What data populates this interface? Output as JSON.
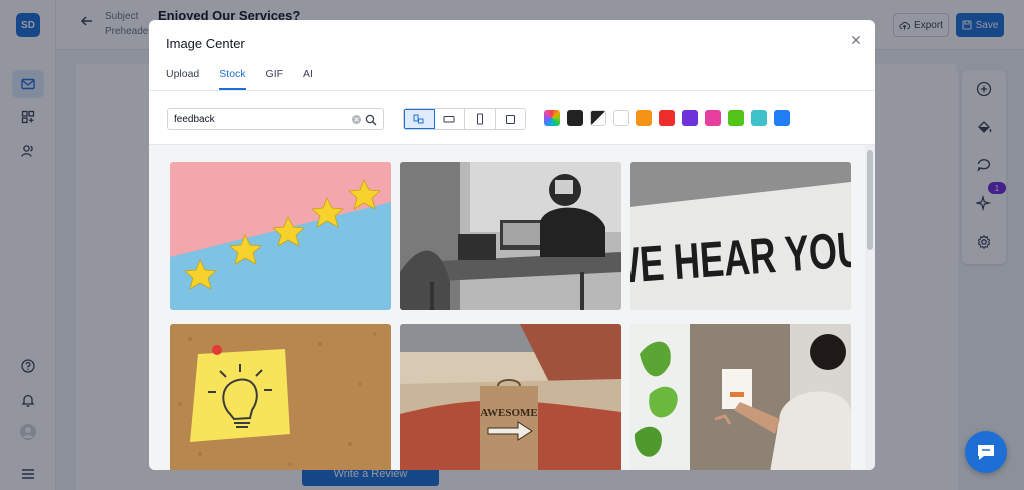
{
  "app": {
    "logo_text": "SD",
    "subject_label": "Subject",
    "preheader_label": "Preheader",
    "subject_value": "Enjoyed Our Services?",
    "export_label": "Export",
    "save_label": "Save",
    "cta_label": "Write a Review",
    "notification_count": "1",
    "brand_color": "#1d6fd6"
  },
  "modal": {
    "title": "Image Center",
    "tabs": [
      {
        "label": "Upload",
        "active": false
      },
      {
        "label": "Stock",
        "active": true
      },
      {
        "label": "GIF",
        "active": false
      },
      {
        "label": "AI",
        "active": false
      }
    ],
    "search": {
      "value": "feedback"
    },
    "orientation_options": [
      "all",
      "landscape",
      "portrait",
      "square"
    ],
    "orientation_selected": "all",
    "color_filters": [
      "multicolor",
      "#222222",
      "black-white",
      "#ffffff",
      "#f59316",
      "#ee2d2d",
      "#6d32d8",
      "#e63fa0",
      "#52c41a",
      "#3fc1c9",
      "#1e7ef2"
    ],
    "images": [
      {
        "name": "five-stars-rating",
        "text": ""
      },
      {
        "name": "people-working-laptops",
        "text": ""
      },
      {
        "name": "we-hear-you-sign",
        "text": "WE HEAR YOU."
      },
      {
        "name": "lightbulb-sticky-note",
        "text": ""
      },
      {
        "name": "awesome-sign-street",
        "text": "AWESOME"
      },
      {
        "name": "feedback-card-on-door",
        "text": ""
      }
    ]
  }
}
